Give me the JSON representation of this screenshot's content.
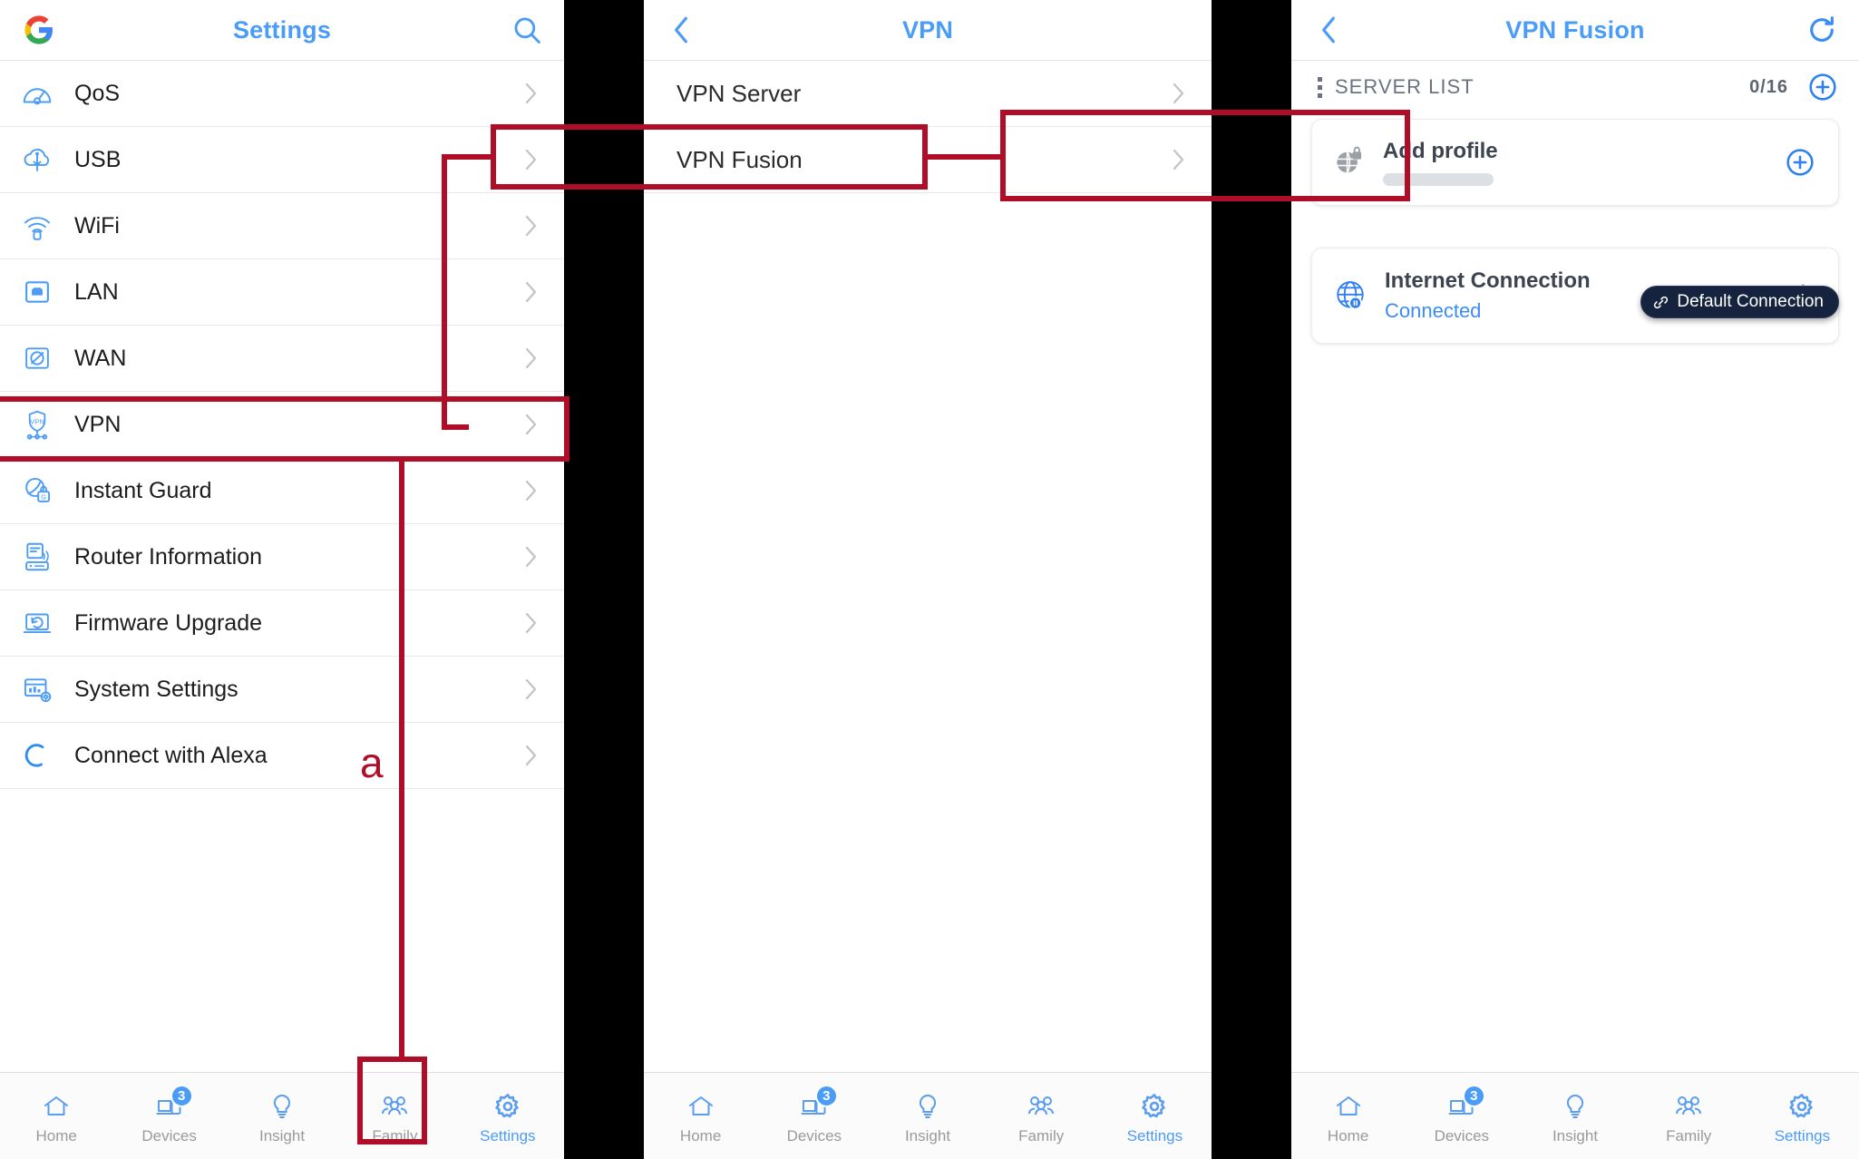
{
  "panels": {
    "settings": {
      "topbar": {
        "logo": "google-g-logo",
        "title": "Settings",
        "right_icon": "search-icon"
      },
      "items": [
        {
          "label": "QoS",
          "icon": "qos-gauge-icon"
        },
        {
          "label": "USB",
          "icon": "usb-cloud-icon"
        },
        {
          "label": "WiFi",
          "icon": "wifi-icon"
        },
        {
          "label": "LAN",
          "icon": "lan-port-icon"
        },
        {
          "label": "WAN",
          "icon": "wan-globe-icon"
        },
        {
          "label": "VPN",
          "icon": "vpn-shield-icon"
        },
        {
          "label": "Instant Guard",
          "icon": "instant-guard-icon"
        },
        {
          "label": "Router Information",
          "icon": "router-info-icon"
        },
        {
          "label": "Firmware Upgrade",
          "icon": "firmware-upgrade-icon"
        },
        {
          "label": "System Settings",
          "icon": "system-settings-icon"
        },
        {
          "label": "Connect with Alexa",
          "icon": "alexa-icon"
        }
      ]
    },
    "vpn": {
      "topbar": {
        "back_icon": "chevron-left-icon",
        "title": "VPN"
      },
      "items": [
        {
          "label": "VPN Server"
        },
        {
          "label": "VPN Fusion"
        }
      ]
    },
    "vpn_fusion": {
      "topbar": {
        "back_icon": "chevron-left-icon",
        "title": "VPN Fusion",
        "right_icon": "refresh-icon"
      },
      "server_list": {
        "drag_icon": "drag-handle-icon",
        "label": "SERVER LIST",
        "count": "0/16",
        "add_icon": "plus-circle-icon"
      },
      "add_profile": {
        "icon": "globe-lock-icon",
        "title": "Add profile",
        "add_icon": "plus-circle-icon"
      },
      "tooltip": {
        "icon": "link-icon",
        "label": "Default Connection"
      },
      "internet_connection": {
        "icon": "globe-pause-icon",
        "title": "Internet Connection",
        "status": "Connected",
        "arrow_icon": "chevron-right-icon"
      }
    }
  },
  "tabbar": [
    {
      "label": "Home",
      "icon": "home-icon",
      "badge": "",
      "active": false
    },
    {
      "label": "Devices",
      "icon": "devices-icon",
      "badge": "3",
      "active": false
    },
    {
      "label": "Insight",
      "icon": "insight-bulb-icon",
      "badge": "",
      "active": false
    },
    {
      "label": "Family",
      "icon": "family-icon",
      "badge": "",
      "active": false
    },
    {
      "label": "Settings",
      "icon": "gear-icon",
      "badge": "",
      "active": true
    }
  ],
  "annotations": {
    "step_letter": "a",
    "accent_color": "#b00d28"
  }
}
